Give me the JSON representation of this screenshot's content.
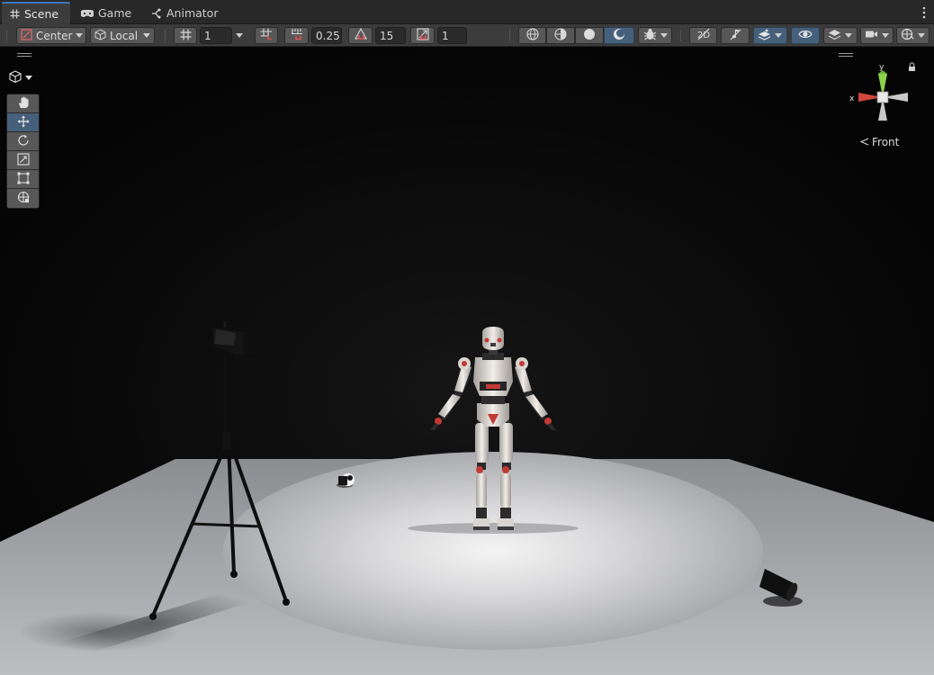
{
  "tabs": [
    {
      "label": "Scene",
      "icon": "grid-icon",
      "active": true
    },
    {
      "label": "Game",
      "icon": "gamepad-icon",
      "active": false
    },
    {
      "label": "Animator",
      "icon": "animator-icon",
      "active": false
    }
  ],
  "toolbar": {
    "pivot_label": "Center",
    "space_label": "Local",
    "grid_size": "1",
    "snap_increment": "0.25",
    "rotation_snap": "15",
    "scale_snap": "1"
  },
  "gizmo": {
    "view_label": "Front",
    "axis_x": "x",
    "axis_y": "y"
  },
  "tools": [
    "hand-tool",
    "move-tool",
    "rotate-tool",
    "scale-tool",
    "rect-tool",
    "transform-tool"
  ],
  "selected_tool": "move-tool",
  "colors": {
    "accent": "#3a79bb",
    "selected": "#46607c",
    "x_axis": "#d0473f",
    "y_axis": "#8ad14c"
  }
}
